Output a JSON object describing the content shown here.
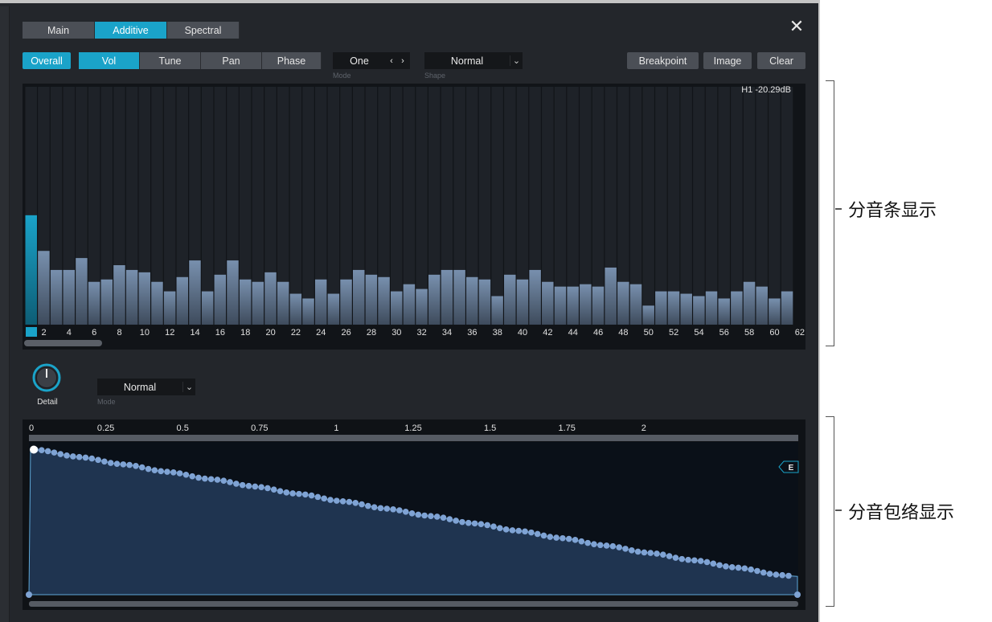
{
  "tabs": [
    {
      "label": "Main",
      "active": false
    },
    {
      "label": "Additive",
      "active": true
    },
    {
      "label": "Spectral",
      "active": false
    }
  ],
  "toolbar": {
    "overall": "Overall",
    "params": [
      {
        "label": "Vol",
        "active": true
      },
      {
        "label": "Tune",
        "active": false
      },
      {
        "label": "Pan",
        "active": false
      },
      {
        "label": "Phase",
        "active": false
      }
    ],
    "mode_value": "One",
    "mode_label": "Mode",
    "shape_value": "Normal",
    "shape_label": "Shape",
    "breakpoint": "Breakpoint",
    "image": "Image",
    "clear": "Clear"
  },
  "partials": {
    "readout": "H1 -20.29dB",
    "selected_index": 1,
    "levels": [
      0.46,
      0.31,
      0.23,
      0.23,
      0.28,
      0.18,
      0.19,
      0.25,
      0.23,
      0.22,
      0.18,
      0.14,
      0.2,
      0.27,
      0.14,
      0.21,
      0.27,
      0.19,
      0.18,
      0.22,
      0.18,
      0.13,
      0.11,
      0.19,
      0.13,
      0.19,
      0.23,
      0.21,
      0.2,
      0.14,
      0.17,
      0.15,
      0.21,
      0.23,
      0.23,
      0.2,
      0.19,
      0.12,
      0.21,
      0.19,
      0.23,
      0.18,
      0.16,
      0.16,
      0.17,
      0.16,
      0.24,
      0.18,
      0.17,
      0.08,
      0.14,
      0.14,
      0.13,
      0.12,
      0.14,
      0.11,
      0.14,
      0.18,
      0.16,
      0.11,
      0.14
    ],
    "axis_labels": [
      "2",
      "4",
      "6",
      "8",
      "10",
      "12",
      "14",
      "16",
      "18",
      "20",
      "22",
      "24",
      "26",
      "28",
      "30",
      "32",
      "34",
      "36",
      "38",
      "40",
      "42",
      "44",
      "46",
      "48",
      "50",
      "52",
      "54",
      "56",
      "58",
      "60",
      "62"
    ]
  },
  "detail": {
    "label": "Detail",
    "mode_value": "Normal",
    "mode_label": "Mode"
  },
  "envelope": {
    "ruler": [
      "0",
      "0.25",
      "0.5",
      "0.75",
      "1",
      "1.25",
      "1.5",
      "1.75",
      "2"
    ],
    "end_marker": "E",
    "start_level": 0.95,
    "end_level": 0.12
  },
  "annotations": {
    "partial_bar_display": "分音条显示",
    "partial_envelope_display": "分音包络显示"
  },
  "colors": {
    "accent": "#1aa3c9",
    "bar": "#6e86a6",
    "envelope_fill": "#1f3450",
    "envelope_point": "#7fa3d4"
  }
}
